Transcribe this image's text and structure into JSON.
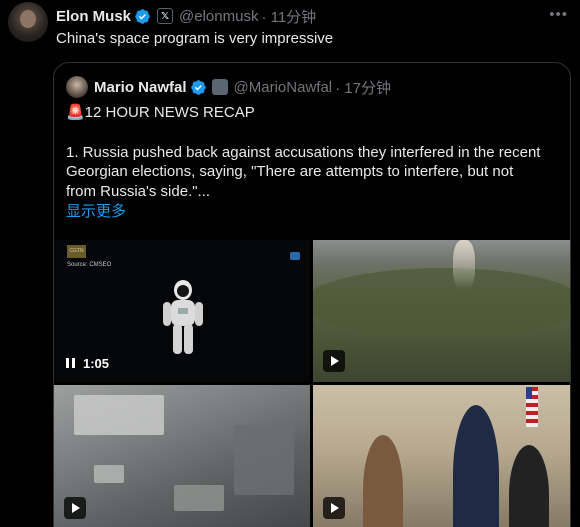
{
  "tweet": {
    "author_name": "Elon Musk",
    "author_handle": "@elonmusk",
    "time": "· 11分钟",
    "more_icon": "more-icon",
    "text": "China's space program is very impressive"
  },
  "quoted": {
    "author_name": "Mario Nawfal",
    "author_handle": "@MarioNawfal",
    "time": "· 17分钟",
    "headline": "🚨12 HOUR NEWS RECAP",
    "body_lines": [
      "1. Russia pushed back against accusations they interfered in the recent",
      "Georgian elections, saying, \"There are attempts to interfere, but not",
      "from Russia's side.\"..."
    ],
    "show_more": "显示更多",
    "media": {
      "video_duration": "1:05",
      "source_label": "Source: CMSEO",
      "watermark": "CGTN"
    }
  },
  "colors": {
    "background": "#000000",
    "text": "#e7e9ea",
    "secondary": "#71767b",
    "link": "#1d9bf0",
    "verified": "#1d9bf0",
    "border": "#2f3336"
  }
}
